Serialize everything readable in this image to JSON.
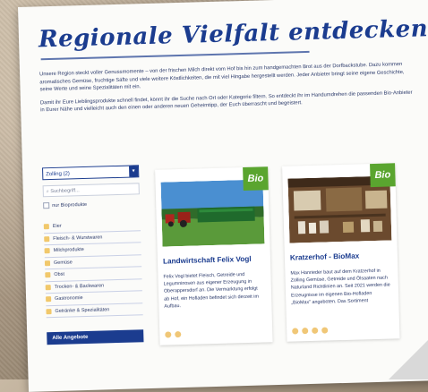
{
  "page": {
    "title": "Regionale Vielfalt entdecken",
    "intro_1": "Unsere Region steckt voller Genussmomente – von der frischen Milch direkt vom Hof bis hin zum handgemachten Brot aus der Dorfbackstube. Dazu kommen aromatisches Gemüse, fruchtige Säfte und viele weitere Köstlichkeiten, die mit viel Hingabe hergestellt werden. Jeder Anbieter bringt seine eigene Geschichte, seine Werte und seine Spezialitäten mit ein.",
    "intro_2": "Damit ihr Eure Lieblingsprodukte schnell findet, könnt ihr die Suche nach Ort oder Kategorie filtern. So entdeckt ihr im Handumdrehen die passenden Bio-Anbieter in Eurer Nähe und vielleicht auch den einen oder anderen neuen Geheimtipp, der Euch überrascht und begeistert."
  },
  "filters": {
    "location": "Zolling (2)",
    "search_placeholder": "Suchbegriff...",
    "bio_only_label": "nur Bioprodukte",
    "categories": [
      "Eier",
      "Fleisch- & Wurstwaren",
      "Milchprodukte",
      "Gemüse",
      "Obst",
      "Trocken- & Backwaren",
      "Gastronomie",
      "Getränke & Spezialitäten"
    ],
    "all_button": "Alle Angebote"
  },
  "cards": [
    {
      "badge": "Bio",
      "name": "Landwirtschaft Felix Vogl",
      "description": "Felix Vogl bietet Fleisch, Getreide und Legumninosen aus eigener Erzeugung in Oberappersdorf an. Die Vermarktung erfolgt ab Hof, ein Hofladen befindet sich derzeit im Aufbau."
    },
    {
      "badge": "Bio",
      "name": "Kratzerhof - BioMax",
      "description": "Max Hanrieder baut auf dem Kratzerhof in Zolling Gemüse, Getreide und Ölsaaten nach Naturland Richtlinien an. Seit 2021 werden die Erzeugnisse im eigenen Bio-Hofladen „BioMax\" angeboten. Das Sortiment"
    }
  ],
  "colors": {
    "accent_blue": "#1b3c8f",
    "bio_green": "#5aa52f",
    "icon_yellow": "#f1c86b"
  }
}
